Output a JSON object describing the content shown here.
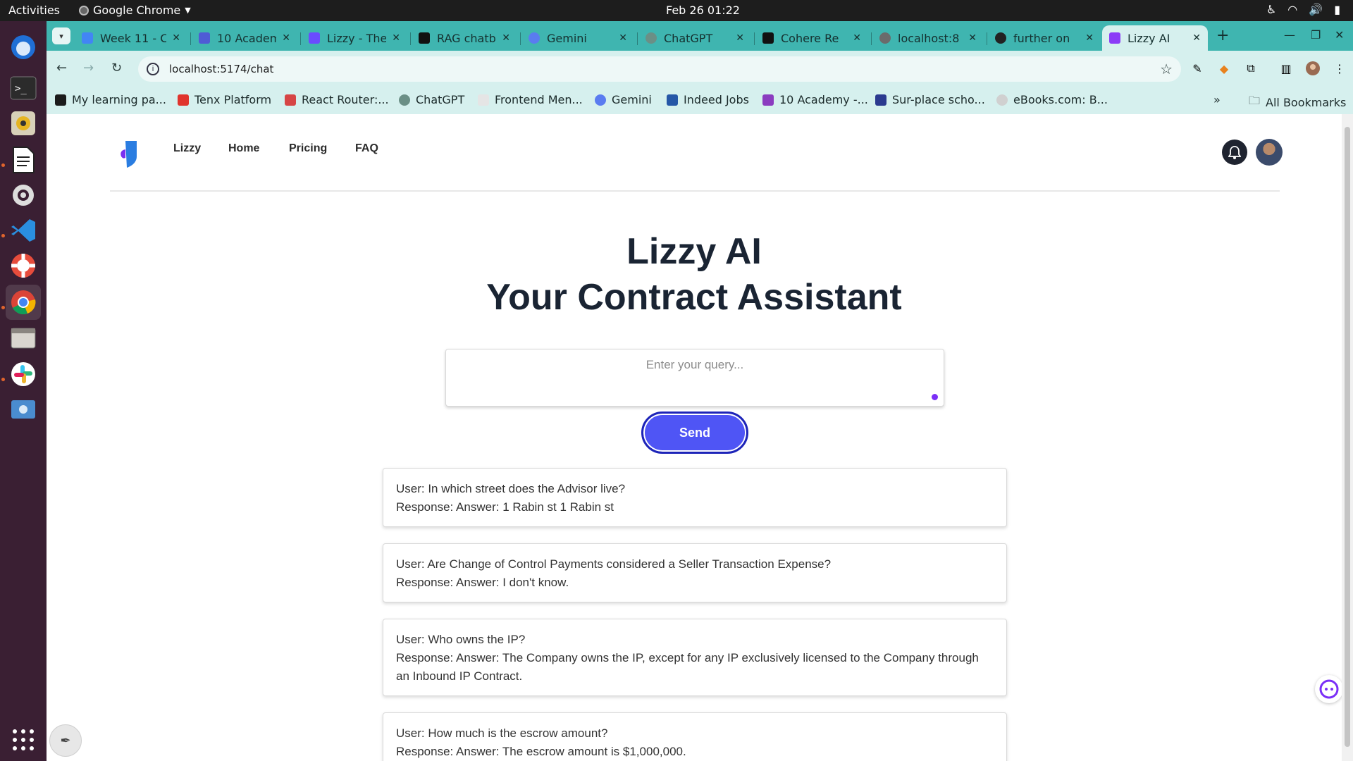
{
  "system_bar": {
    "activities": "Activities",
    "app_name": "Google Chrome",
    "clock": "Feb 26  01:22"
  },
  "dock": {
    "items": [
      "thunderbird-icon",
      "terminal-icon",
      "rhythmbox-icon",
      "text-editor-icon",
      "settings-icon",
      "vscode-icon",
      "help-icon",
      "chrome-icon",
      "files-icon",
      "slack-icon",
      "screenshot-icon"
    ]
  },
  "browser": {
    "tabs": [
      {
        "label": "Week 11 - C",
        "fav_color": "#4285f4"
      },
      {
        "label": "10 Academ",
        "fav_color": "#4f5bd5"
      },
      {
        "label": "Lizzy - The",
        "fav_color": "#6a4cff"
      },
      {
        "label": "RAG chatb",
        "fav_color": "#111111"
      },
      {
        "label": "Gemini",
        "fav_color": "#5a7cf0"
      },
      {
        "label": "ChatGPT",
        "fav_color": "#6b8f86"
      },
      {
        "label": "Cohere Re",
        "fav_color": "#111111"
      },
      {
        "label": "localhost:8",
        "fav_color": "#6b6b6b"
      },
      {
        "label": "further on",
        "fav_color": "#222222"
      },
      {
        "label": "Lizzy AI",
        "fav_color": "#8b3cf7"
      }
    ],
    "url": "localhost:5174/chat",
    "bookmarks": [
      {
        "label": "My learning pa...",
        "color": "#1b1b1b"
      },
      {
        "label": "Tenx Platform",
        "color": "#e0342d"
      },
      {
        "label": "React Router:...",
        "color": "#d64545"
      },
      {
        "label": "ChatGPT",
        "color": "#6b8f86"
      },
      {
        "label": "Frontend Men...",
        "color": "#c9c9c9"
      },
      {
        "label": "Gemini",
        "color": "#5a7cf0"
      },
      {
        "label": "Indeed Jobs",
        "color": "#2557a7"
      },
      {
        "label": "10 Academy -...",
        "color": "#8b3cc0"
      },
      {
        "label": "Sur-place scho...",
        "color": "#2b3a8f"
      },
      {
        "label": "eBooks.com: B...",
        "color": "#b0b0b0"
      }
    ],
    "all_bookmarks": "All Bookmarks"
  },
  "app": {
    "nav": [
      "Lizzy",
      "Home",
      "Pricing",
      "FAQ"
    ],
    "title_line1": "Lizzy AI",
    "title_line2": "Your Contract Assistant",
    "query_placeholder": "Enter your query...",
    "send_label": "Send",
    "conversation": [
      {
        "user": "User: In which street does the Advisor live?",
        "response": "Response: Answer: 1 Rabin st 1 Rabin st"
      },
      {
        "user": "User: Are Change of Control Payments considered a Seller Transaction Expense?",
        "response": "Response: Answer: I don't know."
      },
      {
        "user": "User: Who owns the IP?",
        "response": "Response: Answer: The Company owns the IP, except for any IP exclusively licensed to the Company through an Inbound IP Contract."
      },
      {
        "user": "User: How much is the escrow amount?",
        "response": "Response: Answer: The escrow amount is $1,000,000."
      }
    ],
    "accent_color": "#4f55f5"
  }
}
